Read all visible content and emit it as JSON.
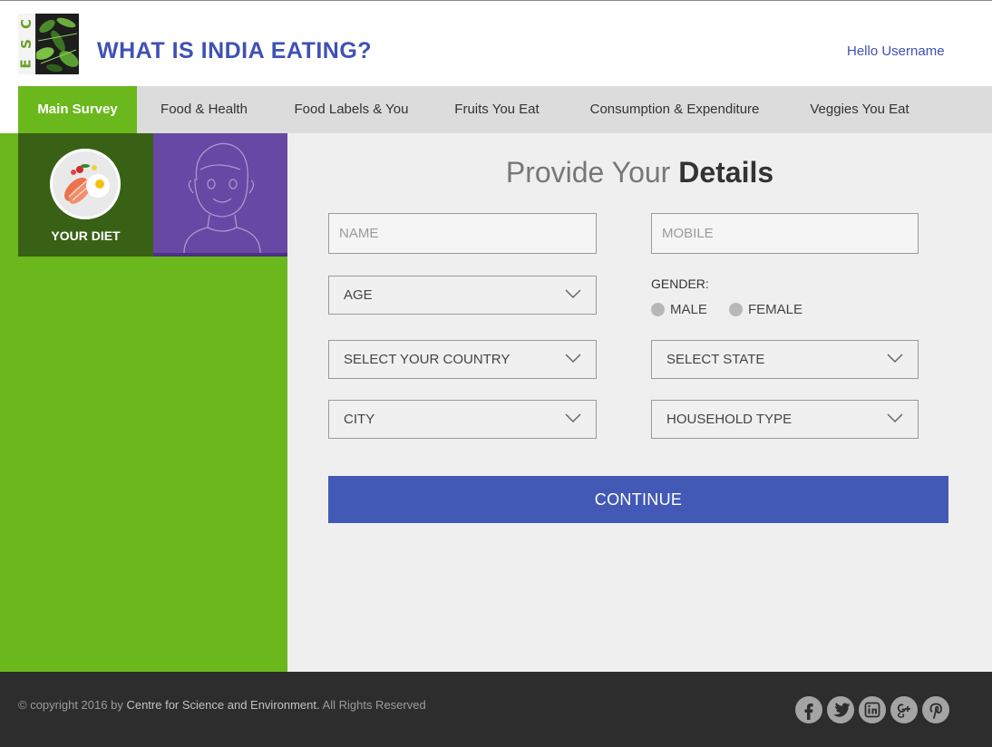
{
  "header": {
    "logo_letters": [
      "C",
      "S",
      "E"
    ],
    "title": "WHAT IS INDIA EATING?",
    "greeting": "Hello Username"
  },
  "nav": {
    "tabs": [
      {
        "label": "Main Survey",
        "active": true
      },
      {
        "label": "Food & Health",
        "active": false
      },
      {
        "label": "Food Labels & You",
        "active": false
      },
      {
        "label": "Fruits You Eat",
        "active": false
      },
      {
        "label": "Consumption & Expenditure",
        "active": false
      },
      {
        "label": "Veggies You Eat",
        "active": false
      }
    ]
  },
  "sidebar": {
    "diet_tile_label": "YOUR DIET"
  },
  "form": {
    "title_light": "Provide Your",
    "title_bold": "Details",
    "name_placeholder": "NAME",
    "mobile_placeholder": "MOBILE",
    "age_label": "AGE",
    "gender_label": "GENDER:",
    "gender_options": [
      "MALE",
      "FEMALE"
    ],
    "country_label": "SELECT YOUR COUNTRY",
    "state_label": "SELECT STATE",
    "city_label": "CITY",
    "household_label": "HOUSEHOLD TYPE",
    "continue_label": "CONTINUE"
  },
  "footer": {
    "copyright_prefix": "© copyright 2016 by",
    "copyright_org": "Centre for Science and Environment.",
    "copyright_suffix": "All Rights Reserved",
    "social_icons": [
      "facebook-icon",
      "twitter-icon",
      "linkedin-icon",
      "google-plus-icon",
      "pinterest-icon"
    ]
  },
  "colors": {
    "brand_blue": "#3f51b5",
    "button_blue": "#4259b5",
    "green": "#6bb81c",
    "dark_green": "#396116",
    "purple": "#6748a4",
    "footer_bg": "#2d2d2d"
  }
}
